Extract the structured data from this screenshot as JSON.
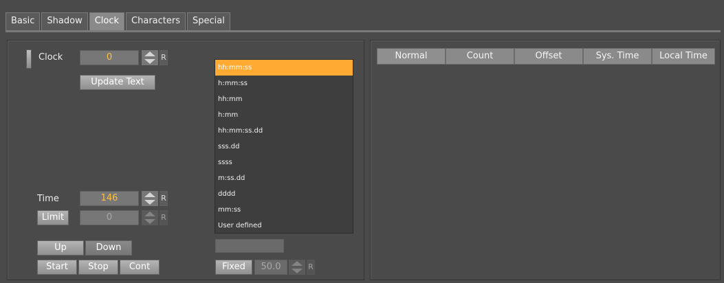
{
  "tabs": [
    "Basic",
    "Shadow",
    "Clock",
    "Characters",
    "Special"
  ],
  "clock": {
    "label": "Clock",
    "value": "0",
    "reset": "R",
    "update_text": "Update Text"
  },
  "formats": {
    "items": [
      "hh:mm:ss",
      "h:mm:ss",
      "hh:mm",
      "h:mm",
      "hh:mm:ss.dd",
      "sss.dd",
      "ssss",
      "m:ss.dd",
      "dddd",
      "mm:ss",
      "User defined"
    ],
    "selected": "hh:mm:ss"
  },
  "time": {
    "label": "Time",
    "value": "146",
    "reset": "R",
    "limit_button": "Limit",
    "limit_value": "0",
    "limit_reset": "R"
  },
  "direction": {
    "up": "Up",
    "down": "Down"
  },
  "controls": {
    "start": "Start",
    "stop": "Stop",
    "cont": "Cont"
  },
  "fixed": {
    "button": "Fixed",
    "value": "50.0",
    "reset": "R"
  },
  "modes": [
    "Normal",
    "Count",
    "Offset",
    "Sys. Time",
    "Local Time"
  ],
  "colors": {
    "accent": "#ffaa33",
    "field_value": "#ffbf40"
  }
}
